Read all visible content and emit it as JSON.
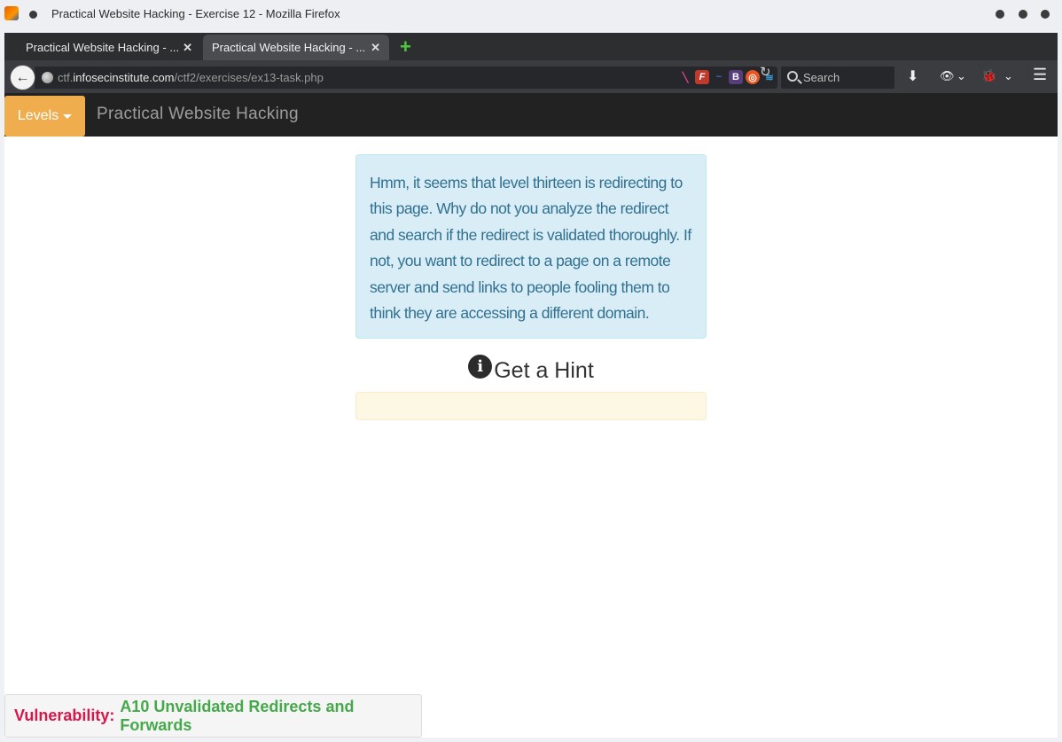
{
  "window": {
    "title": "Practical Website Hacking - Exercise 12 - Mozilla Firefox"
  },
  "tabs": [
    {
      "label": "Practical Website Hacking - ...",
      "active": false
    },
    {
      "label": "Practical Website Hacking - ...",
      "active": true
    }
  ],
  "navbar": {
    "url_prefix": "ctf.",
    "url_domain": "infosecinstitute.com",
    "url_path": "/ctf2/exercises/ex13-task.php",
    "search_placeholder": "Search"
  },
  "site": {
    "levels_label": "Levels",
    "brand": "Practical Website Hacking"
  },
  "content": {
    "task_text": "Hmm, it seems that level thirteen is redirecting to this page. Why do not you analyze the redirect and search if the redirect is validated thoroughly. If not, you want to redirect to a page on a remote server and send links to people fooling them to think they are accessing a different domain.",
    "hint_title": "Get a Hint",
    "hint_body": ""
  },
  "footer": {
    "vuln_label": "Vulnerability:",
    "vuln_value": "A10 Unvalidated Redirects and Forwards"
  },
  "colors": {
    "levels_button": "#f0ad4e",
    "info_bg": "#d9edf7",
    "info_text": "#31708f",
    "hint_bg": "#fcf8e3",
    "vuln_label": "#d9164a",
    "vuln_value": "#45a84a"
  }
}
